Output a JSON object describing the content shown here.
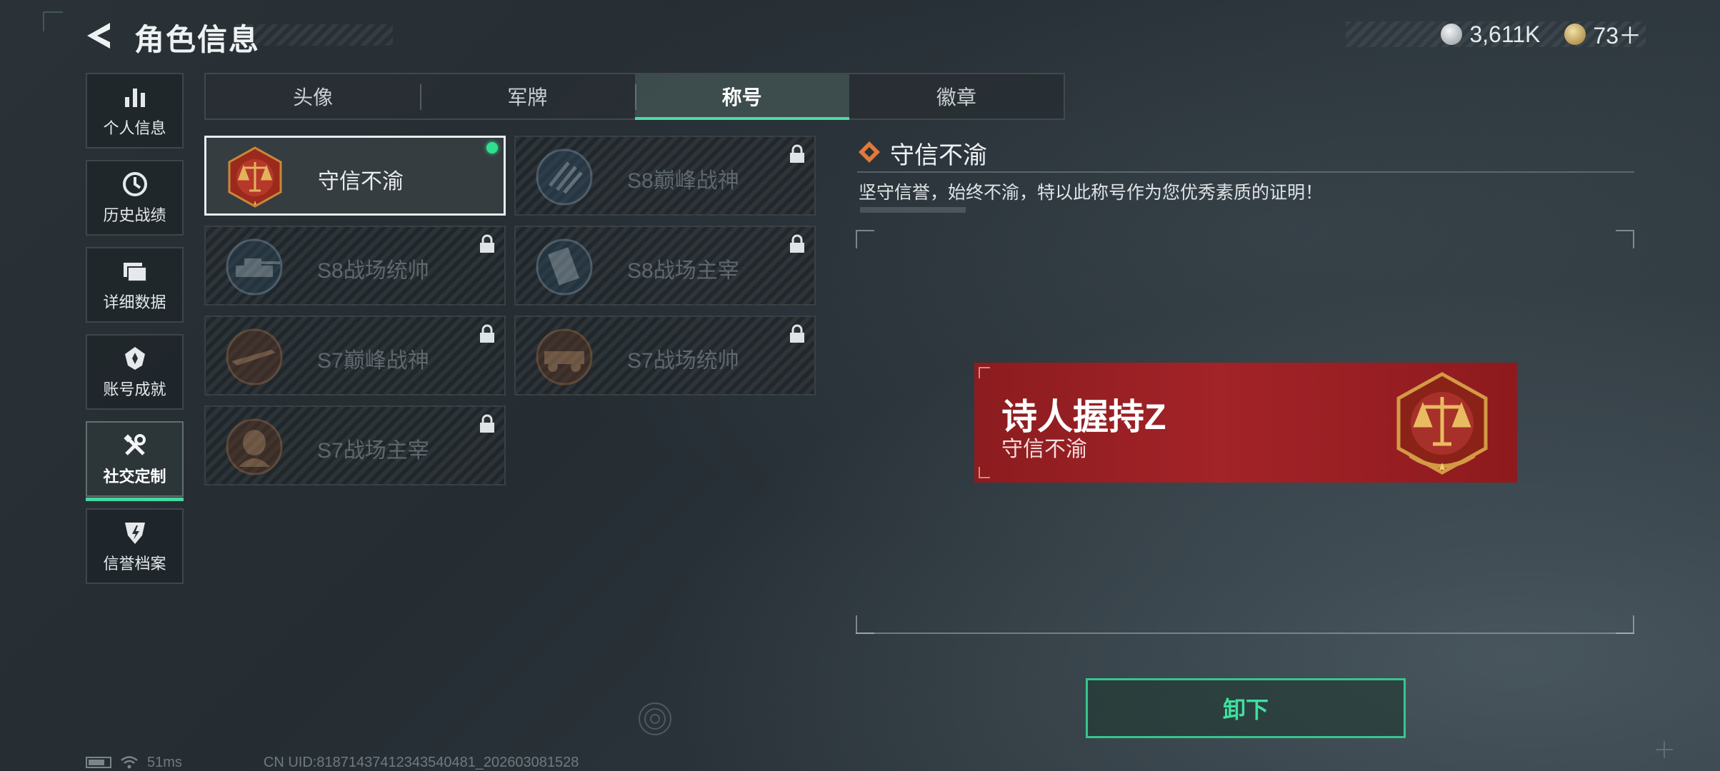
{
  "header": {
    "title": "角色信息",
    "currency_primary": "3,611K",
    "currency_secondary": "73＋",
    "colors": {
      "accent": "#45d7a0",
      "coin_silver": "#c6ccd0",
      "coin_gold": "#c9a45a"
    }
  },
  "sidebar": {
    "items": [
      {
        "label": "个人信息",
        "icon": "bar-chart-icon"
      },
      {
        "label": "历史战绩",
        "icon": "clock-icon"
      },
      {
        "label": "详细数据",
        "icon": "folder-icon"
      },
      {
        "label": "账号成就",
        "icon": "achievement-icon"
      },
      {
        "label": "社交定制",
        "icon": "tools-icon",
        "active": true
      },
      {
        "label": "信誉档案",
        "icon": "shield-icon"
      }
    ]
  },
  "tabs": [
    {
      "label": "头像"
    },
    {
      "label": "军牌"
    },
    {
      "label": "称号",
      "active": true
    },
    {
      "label": "徽章"
    }
  ],
  "titles": [
    {
      "name": "守信不渝",
      "locked": false,
      "equipped": true
    },
    {
      "name": "S8巅峰战神",
      "locked": true
    },
    {
      "name": "S8战场统帅",
      "locked": true
    },
    {
      "name": "S8战场主宰",
      "locked": true
    },
    {
      "name": "S7巅峰战神",
      "locked": true
    },
    {
      "name": "S7战场统帅",
      "locked": true
    },
    {
      "name": "S7战场主宰",
      "locked": true
    }
  ],
  "detail": {
    "title": "守信不渝",
    "description": "坚守信誉，始终不渝，特以此称号作为您优秀素质的证明！",
    "preview": {
      "nickname": "诗人握持Z",
      "title": "守信不渝",
      "color": "#a22328"
    },
    "action_label": "卸下"
  },
  "footer": {
    "ping": "51ms",
    "uid": "CN UID:818714374123435404​81_202603081528"
  }
}
